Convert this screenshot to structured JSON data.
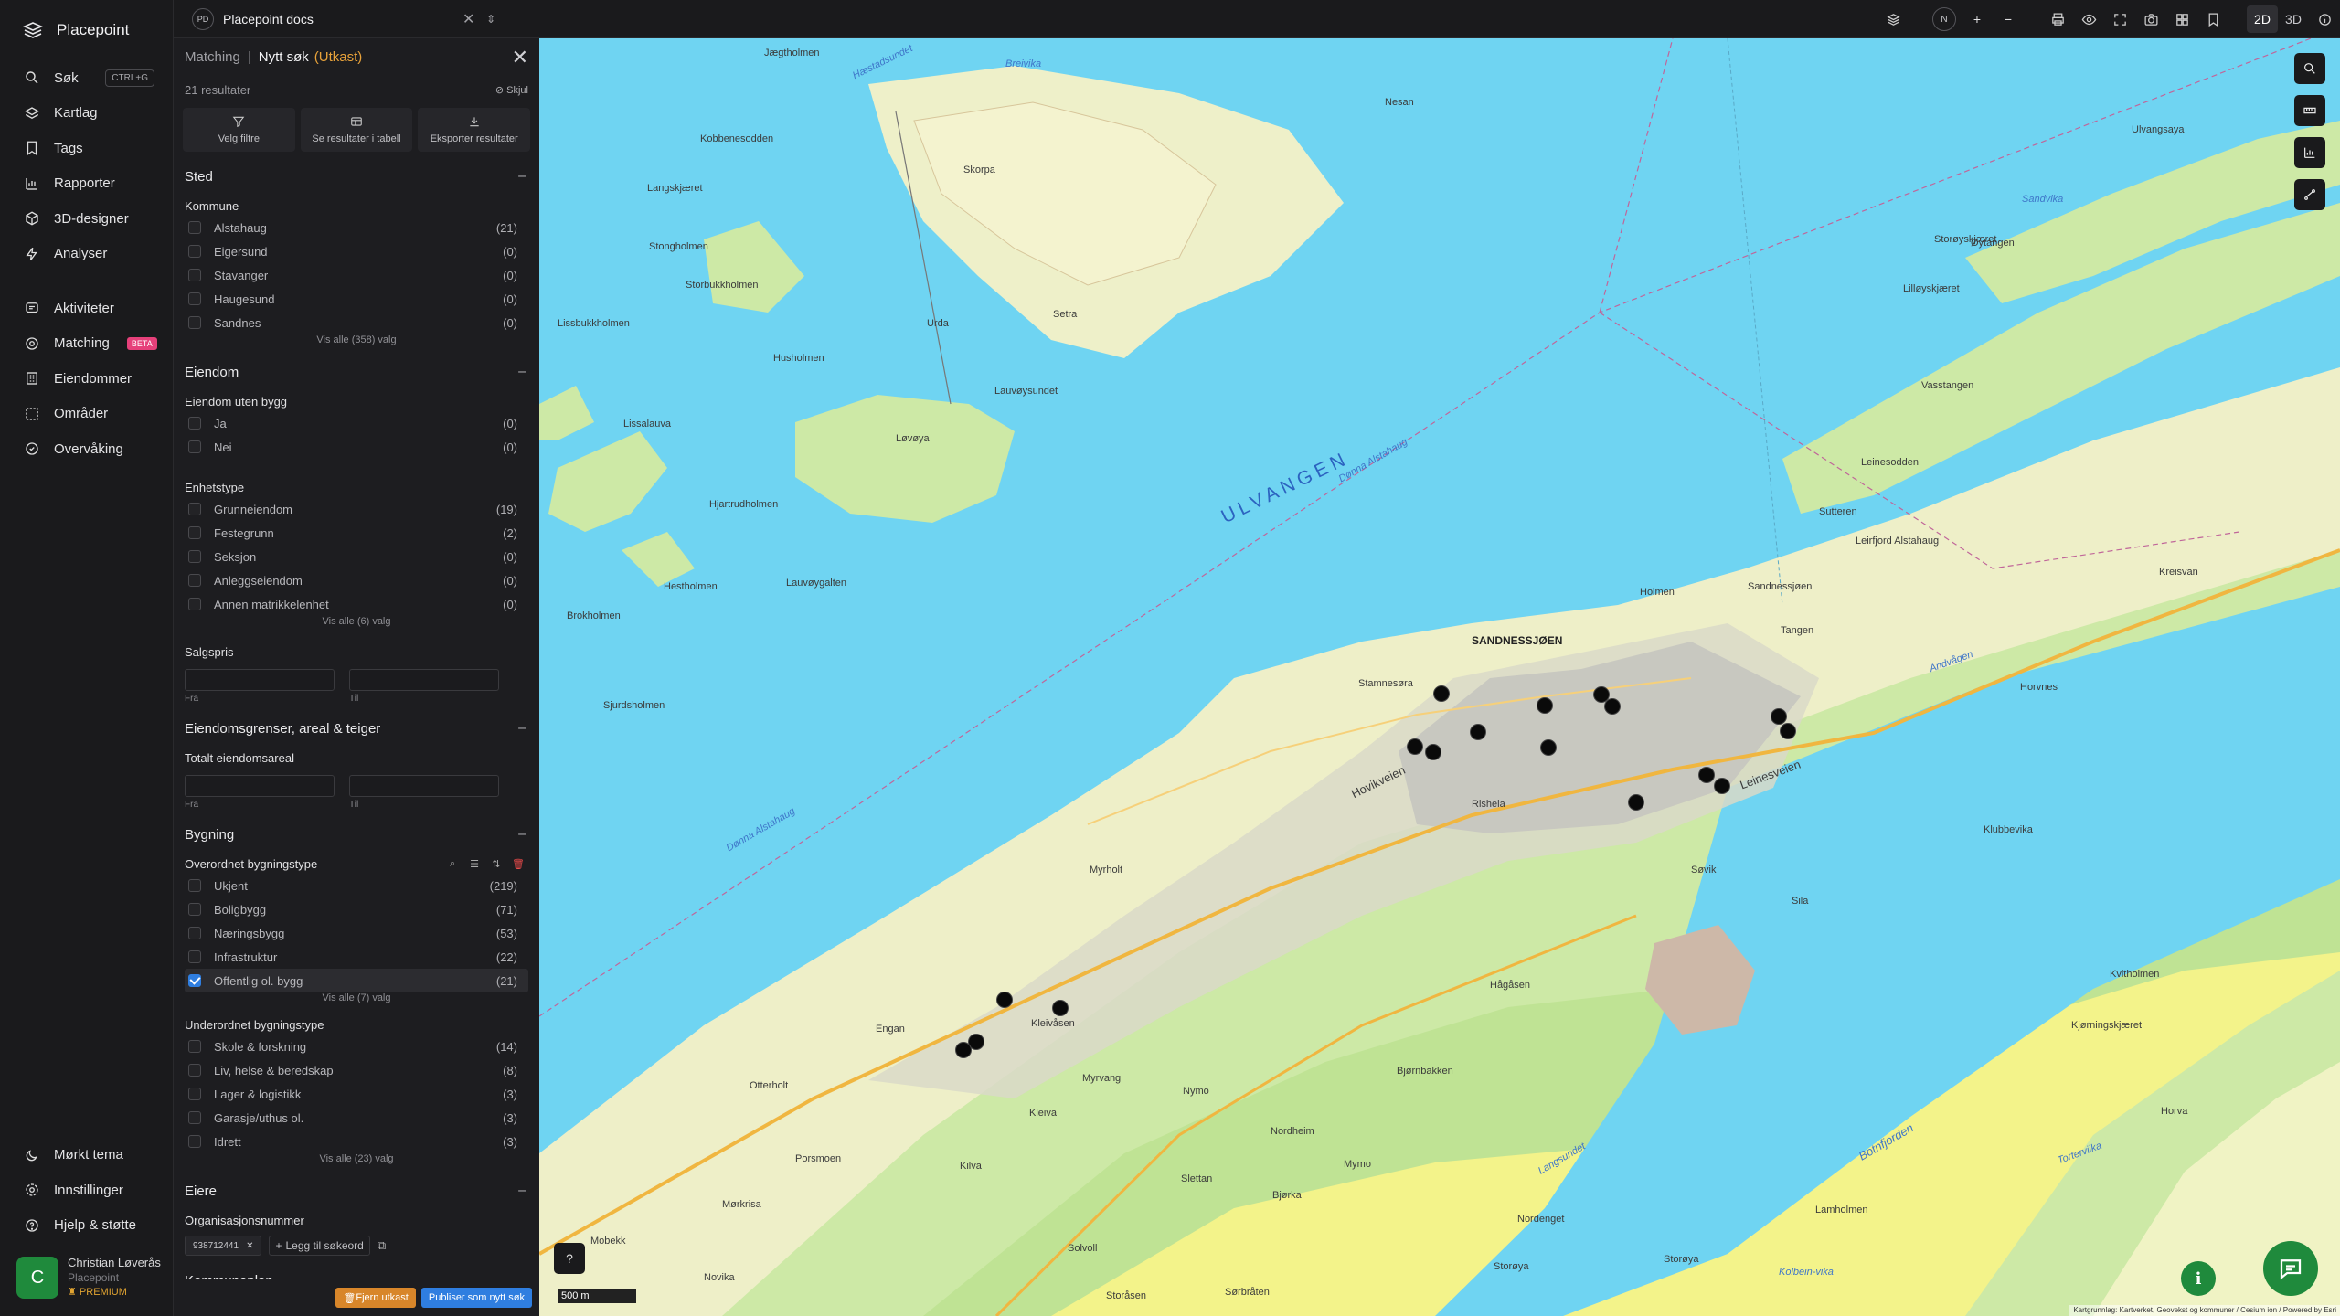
{
  "app": {
    "name": "Placepoint"
  },
  "nav": {
    "items": [
      {
        "label": "Søk",
        "icon": "search-icon",
        "kbd": "CTRL+G"
      },
      {
        "label": "Kartlag",
        "icon": "layers-icon"
      },
      {
        "label": "Tags",
        "icon": "bookmark-icon"
      },
      {
        "label": "Rapporter",
        "icon": "bar-chart-icon"
      },
      {
        "label": "3D-designer",
        "icon": "cube-icon"
      },
      {
        "label": "Analyser",
        "icon": "bolt-icon"
      }
    ],
    "items2": [
      {
        "label": "Aktiviteter",
        "icon": "activity-icon"
      },
      {
        "label": "Matching",
        "icon": "target-icon",
        "badge": "BETA"
      },
      {
        "label": "Eiendommer",
        "icon": "building-icon"
      },
      {
        "label": "Områder",
        "icon": "area-icon"
      },
      {
        "label": "Overvåking",
        "icon": "monitor-icon"
      }
    ],
    "bottom": [
      {
        "label": "Mørkt tema",
        "icon": "moon-icon"
      },
      {
        "label": "Innstillinger",
        "icon": "gear-icon"
      },
      {
        "label": "Hjelp & støtte",
        "icon": "help-icon"
      }
    ],
    "user": {
      "initial": "C",
      "name": "Christian Løverås",
      "org": "Placepoint",
      "plan": "PREMIUM"
    }
  },
  "topbar": {
    "doc_initials": "PD",
    "doc_name": "Placepoint docs",
    "mode_2d": "2D",
    "mode_3d": "3D",
    "compass": "N"
  },
  "panel": {
    "crumb": "Matching",
    "title": "Nytt søk",
    "draft": "(Utkast)",
    "results": "21 resultater",
    "hide": "Skjul",
    "actions": [
      "Velg filtre",
      "Se resultater i tabell",
      "Eksporter resultater"
    ],
    "sted": {
      "title": "Sted",
      "kommune_label": "Kommune",
      "options": [
        {
          "label": "Alstahaug",
          "count": "(21)"
        },
        {
          "label": "Eigersund",
          "count": "(0)"
        },
        {
          "label": "Stavanger",
          "count": "(0)"
        },
        {
          "label": "Haugesund",
          "count": "(0)"
        },
        {
          "label": "Sandnes",
          "count": "(0)"
        }
      ],
      "show_all": "Vis alle (358) valg"
    },
    "eiendom": {
      "title": "Eiendom",
      "uten_bygg_label": "Eiendom uten bygg",
      "uten_bygg": [
        {
          "label": "Ja",
          "count": "(0)"
        },
        {
          "label": "Nei",
          "count": "(0)"
        }
      ],
      "enhetstype_label": "Enhetstype",
      "enhetstype": [
        {
          "label": "Grunneiendom",
          "count": "(19)"
        },
        {
          "label": "Festegrunn",
          "count": "(2)"
        },
        {
          "label": "Seksjon",
          "count": "(0)"
        },
        {
          "label": "Anleggseiendom",
          "count": "(0)"
        },
        {
          "label": "Annen matrikkelenhet",
          "count": "(0)"
        }
      ],
      "show_all": "Vis alle (6) valg",
      "salgspris_label": "Salgspris",
      "from": "Fra",
      "to": "Til"
    },
    "grenser": {
      "title": "Eiendomsgrenser, areal & teiger",
      "areal_label": "Totalt eiendomsareal",
      "from": "Fra",
      "to": "Til"
    },
    "bygning": {
      "title": "Bygning",
      "overordnet_label": "Overordnet bygningstype",
      "overordnet": [
        {
          "label": "Ukjent",
          "count": "(219)"
        },
        {
          "label": "Boligbygg",
          "count": "(71)"
        },
        {
          "label": "Næringsbygg",
          "count": "(53)"
        },
        {
          "label": "Infrastruktur",
          "count": "(22)"
        },
        {
          "label": "Offentlig ol. bygg",
          "count": "(21)"
        }
      ],
      "show_all_1": "Vis alle (7) valg",
      "underordnet_label": "Underordnet bygningstype",
      "underordnet": [
        {
          "label": "Skole & forskning",
          "count": "(14)"
        },
        {
          "label": "Liv, helse & beredskap",
          "count": "(8)"
        },
        {
          "label": "Lager & logistikk",
          "count": "(3)"
        },
        {
          "label": "Garasje/uthus ol.",
          "count": "(3)"
        },
        {
          "label": "Idrett",
          "count": "(3)"
        }
      ],
      "show_all_2": "Vis alle (23) valg"
    },
    "eiere": {
      "title": "Eiere",
      "org_label": "Organisasjonsnummer",
      "org_value": "938712441",
      "add_keyword": "Legg til søkeord"
    },
    "kommuneplan": {
      "title": "Kommuneplan"
    },
    "footer": {
      "remove_draft": "Fjern utkast",
      "publish": "Publiser som nytt søk"
    }
  },
  "map": {
    "labels": {
      "ulvangen": "ULVANGEN",
      "sandnessjoen": "SANDNESSJØEN",
      "jaegtholmen": "Jægtholmen",
      "haestadsundet": "Hæstadsundet",
      "breivika": "Breivika",
      "nesan": "Nesan",
      "kobbenesodden": "Kobbenesodden",
      "skorpa": "Skorpa",
      "langskjaeret": "Langskjæret",
      "stongholmen": "Stongholmen",
      "storbukkholmen": "Storbukkholmen",
      "lissbukkholmen": "Lissbukkholmen",
      "husholmen": "Husholmen",
      "urda": "Urda",
      "setra": "Setra",
      "lauvoysundet": "Lauvøysundet",
      "lovoya": "Løvøya",
      "lissalauva": "Lissalauva",
      "hjartrudholmen": "Hjartrudholmen",
      "hestholmen": "Hestholmen",
      "lauvoygalten": "Lauvøygalten",
      "brokholmen": "Brokholmen",
      "sjurdsholmen": "Sjurdsholmen",
      "stamnesora": "Stamnesøra",
      "hovikveien": "Hovikveien",
      "holmen": "Holmen",
      "tangen": "Tangen",
      "sandnessjoen2": "Sandnessjøen",
      "leinesveien": "Leinesveien",
      "risheia": "Risheia",
      "myrholt": "Myrholt",
      "kleivasen": "Kleivåsen",
      "engan": "Engan",
      "otterholt": "Otterholt",
      "myrvang": "Myrvang",
      "nymo": "Nymo",
      "hagasen": "Hågåsen",
      "bjornbakken": "Bjørnbakken",
      "nordheim": "Nordheim",
      "slettan": "Slettan",
      "bjorka": "Bjørka",
      "mymo": "Mymo",
      "langsund": "Langsundet",
      "botnfjorden": "Botnfjorden",
      "kjorningskjaeret": "Kjørningskjæret",
      "kvitholmen": "Kvitholmen",
      "horva": "Horva",
      "lamholmen": "Lamholmen",
      "kolbeinvika": "Kolbein-vika",
      "storoya": "Storøya",
      "sandvika": "Sandvika",
      "ulvangsaya": "Ulvangsaya",
      "storoyskjaeret": "Storøyskjæret",
      "lillskjaeret": "Lilløyskjæret",
      "oytangen": "Øytangen",
      "vasstangen": "Vasstangen",
      "leinesodden": "Leinesodden",
      "sutterfen": "Sutteren",
      "leirfjord": "Leirfjord Alstahaug",
      "kreisvan": "Kreisvan",
      "horvnes": "Horvnes",
      "andvagen": "Andvågen",
      "sovik": "Søvik",
      "sila": "Sila",
      "klubbevika": "Klubbevika",
      "dennaA": "Dønna Alstahaug",
      "dennaB": "Dønna Alstahaug",
      "porsmoen": "Porsmoen",
      "kleiva": "Kleiva",
      "kilva": "Kilva",
      "morkrisa": "Mørkrisa",
      "solvoll": "Solvoll",
      "mobekk": "Mobekk",
      "novika": "Novika",
      "sorbraaten": "Sørbråten",
      "storaasen": "Storåsen",
      "nordengen": "Nordenget",
      "storeya": "Storøya",
      "torterviika": "Torterviika"
    },
    "scale": "500 m",
    "attribution": "Kartgrunnlag: Kartverket, Geovekst og kommuner / Cesium ion / Powered by Esri"
  }
}
